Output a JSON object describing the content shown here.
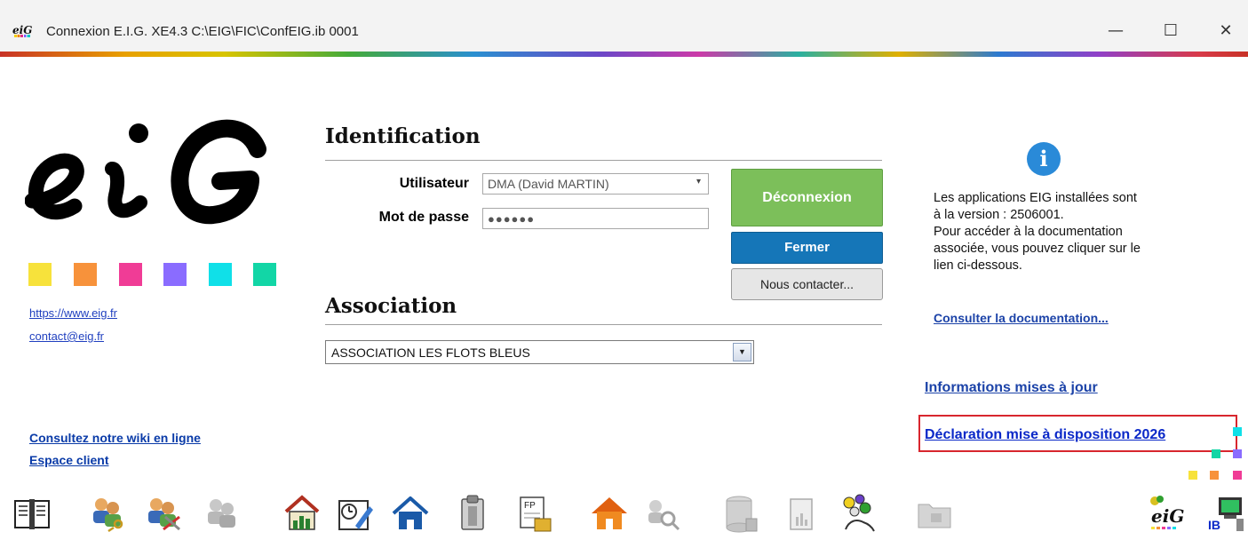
{
  "window": {
    "title": "Connexion E.I.G. XE4.3 C:\\EIG\\FIC\\ConfEIG.ib 0001",
    "app_icon_label": "eiG",
    "minimize": "—",
    "maximize": "☐",
    "close": "✕"
  },
  "brand": {
    "squares": [
      "#f7e23b",
      "#f7923b",
      "#f03c96",
      "#8a6cff",
      "#10e0e8",
      "#12d6a6"
    ],
    "links": {
      "website": "https://www.eig.fr",
      "contact": "contact@eig.fr",
      "wiki": "Consultez notre wiki en ligne",
      "client_space": "Espace client"
    }
  },
  "identification": {
    "title": "Identification",
    "user_label": "Utilisateur",
    "user_value": "DMA (David MARTIN)",
    "password_label": "Mot de passe",
    "password_value": "●●●●●●"
  },
  "buttons": {
    "disconnect": "Déconnexion",
    "close": "Fermer",
    "contact": "Nous contacter..."
  },
  "association": {
    "title": "Association",
    "selected": "ASSOCIATION LES FLOTS BLEUS"
  },
  "info": {
    "lines": [
      "Les applications EIG installées sont",
      "à la version : 2506001.",
      "Pour accéder à la documentation",
      "associée, vous pouvez cliquer sur le",
      "lien ci-dessous."
    ],
    "doc_link": "Consulter la documentation...",
    "updates_link": "Informations mises à jour",
    "declaration_link": "Déclaration mise à disposition 2026"
  },
  "toolbar": {
    "icons": [
      "book-icon",
      "users-key-icon",
      "users-tools-icon",
      "users-grey-icon",
      "house-chart-icon",
      "calendar-edit-icon",
      "home-icon",
      "document-clip-icon",
      "fp-document-icon",
      "house-orange-icon",
      "search-grey-icon",
      "server-grey-icon",
      "document-grey-icon",
      "hand-dots-icon",
      "folder-grey-icon",
      "eig-logo-icon",
      "ib-computer-icon"
    ],
    "eig_label": "eiG",
    "ib_label": "IB"
  }
}
